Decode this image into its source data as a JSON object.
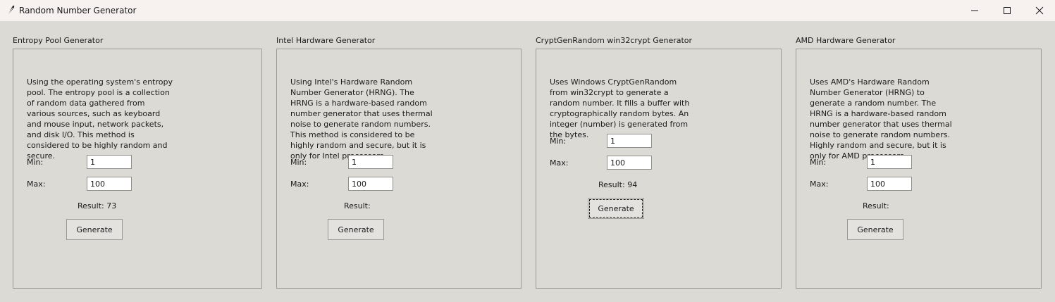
{
  "window": {
    "title": "Random Number Generator",
    "icon": "feather-icon",
    "controls": [
      "minimize-icon",
      "maximize-icon",
      "close-icon"
    ]
  },
  "panels": [
    {
      "title": "Entropy Pool Generator",
      "description": [
        "Using the operating system's entropy",
        "pool. The entropy pool is a collection",
        "of random data gathered from",
        "various sources, such as keyboard",
        "and mouse input, network packets,",
        "and disk I/O. This method is",
        "considered to be highly random and",
        "secure."
      ],
      "min_label": "Min:",
      "min_value": "1",
      "max_label": "Max:",
      "max_value": "100",
      "result": "Result: 73",
      "button": "Generate"
    },
    {
      "title": "Intel Hardware Generator",
      "description": [
        "Using Intel's Hardware Random",
        "Number Generator (HRNG). The",
        "HRNG is a hardware-based random",
        "number generator that uses thermal",
        "noise to generate random numbers.",
        "This method is considered to be",
        "highly random and secure, but it is",
        "only for Intel processors."
      ],
      "min_label": "Min:",
      "min_value": "1",
      "max_label": "Max:",
      "max_value": "100",
      "result": "Result:",
      "button": "Generate"
    },
    {
      "title": "CryptGenRandom win32crypt Generator",
      "description": [
        "Uses Windows CryptGenRandom",
        "from win32crypt to generate a",
        "random number. It fills a buffer with",
        "cryptographically random bytes. An",
        "integer (number) is generated from",
        "the bytes."
      ],
      "min_label": "Min:",
      "min_value": "1",
      "max_label": "Max:",
      "max_value": "100",
      "result": "Result: 94",
      "button": "Generate"
    },
    {
      "title": "AMD Hardware Generator",
      "description": [
        "Uses AMD's Hardware Random",
        "Number Generator (HRNG) to",
        "generate a random number. The",
        "HRNG is a hardware-based random",
        "number generator that uses thermal",
        "noise to generate random numbers.",
        "Highly random and secure, but it is",
        "only for AMD processors."
      ],
      "min_label": "Min:",
      "min_value": "1",
      "max_label": "Max:",
      "max_value": "100",
      "result": "Result:",
      "button": "Generate"
    }
  ]
}
